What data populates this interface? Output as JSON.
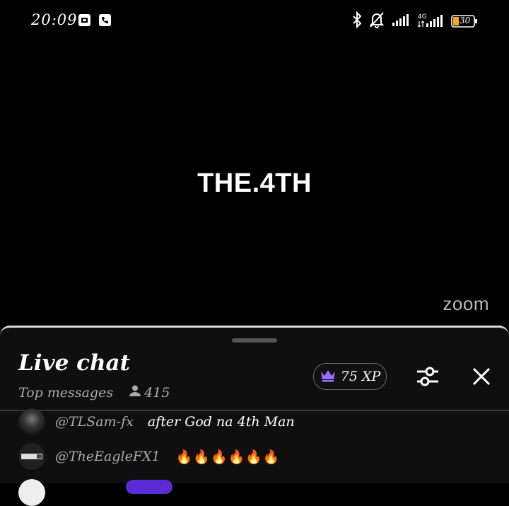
{
  "status_bar": {
    "time": "20:09",
    "battery": "30",
    "network": "4G"
  },
  "stream": {
    "title": "THE.4TH",
    "watermark": "zoom"
  },
  "chat": {
    "title": "Live chat",
    "mode": "Top messages",
    "viewer_count": "415",
    "xp": "75 XP",
    "messages": [
      {
        "author": "@TLSam-fx",
        "text": "after God na 4th Man"
      },
      {
        "author": "@TheEagleFX1",
        "text": "🔥🔥🔥🔥🔥🔥"
      }
    ]
  },
  "colors": {
    "crown": "#9b6cff",
    "background": "#000000",
    "panel": "#0f0f0f"
  }
}
